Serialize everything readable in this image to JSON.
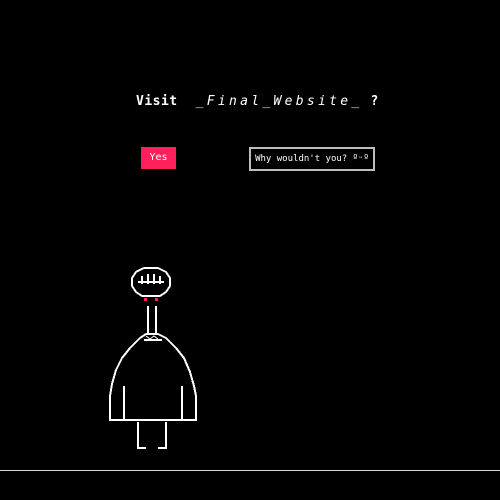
{
  "prompt": {
    "visit_label": "Visit",
    "site_name": "_Final_Website_",
    "question_mark": "?"
  },
  "buttons": {
    "yes_label": "Yes",
    "why_label": "Why wouldn't you? ºᵕº"
  },
  "colors": {
    "background": "#000000",
    "accent": "#ff1f5a",
    "text": "#ffffff",
    "outline": "#bdbdbd"
  }
}
